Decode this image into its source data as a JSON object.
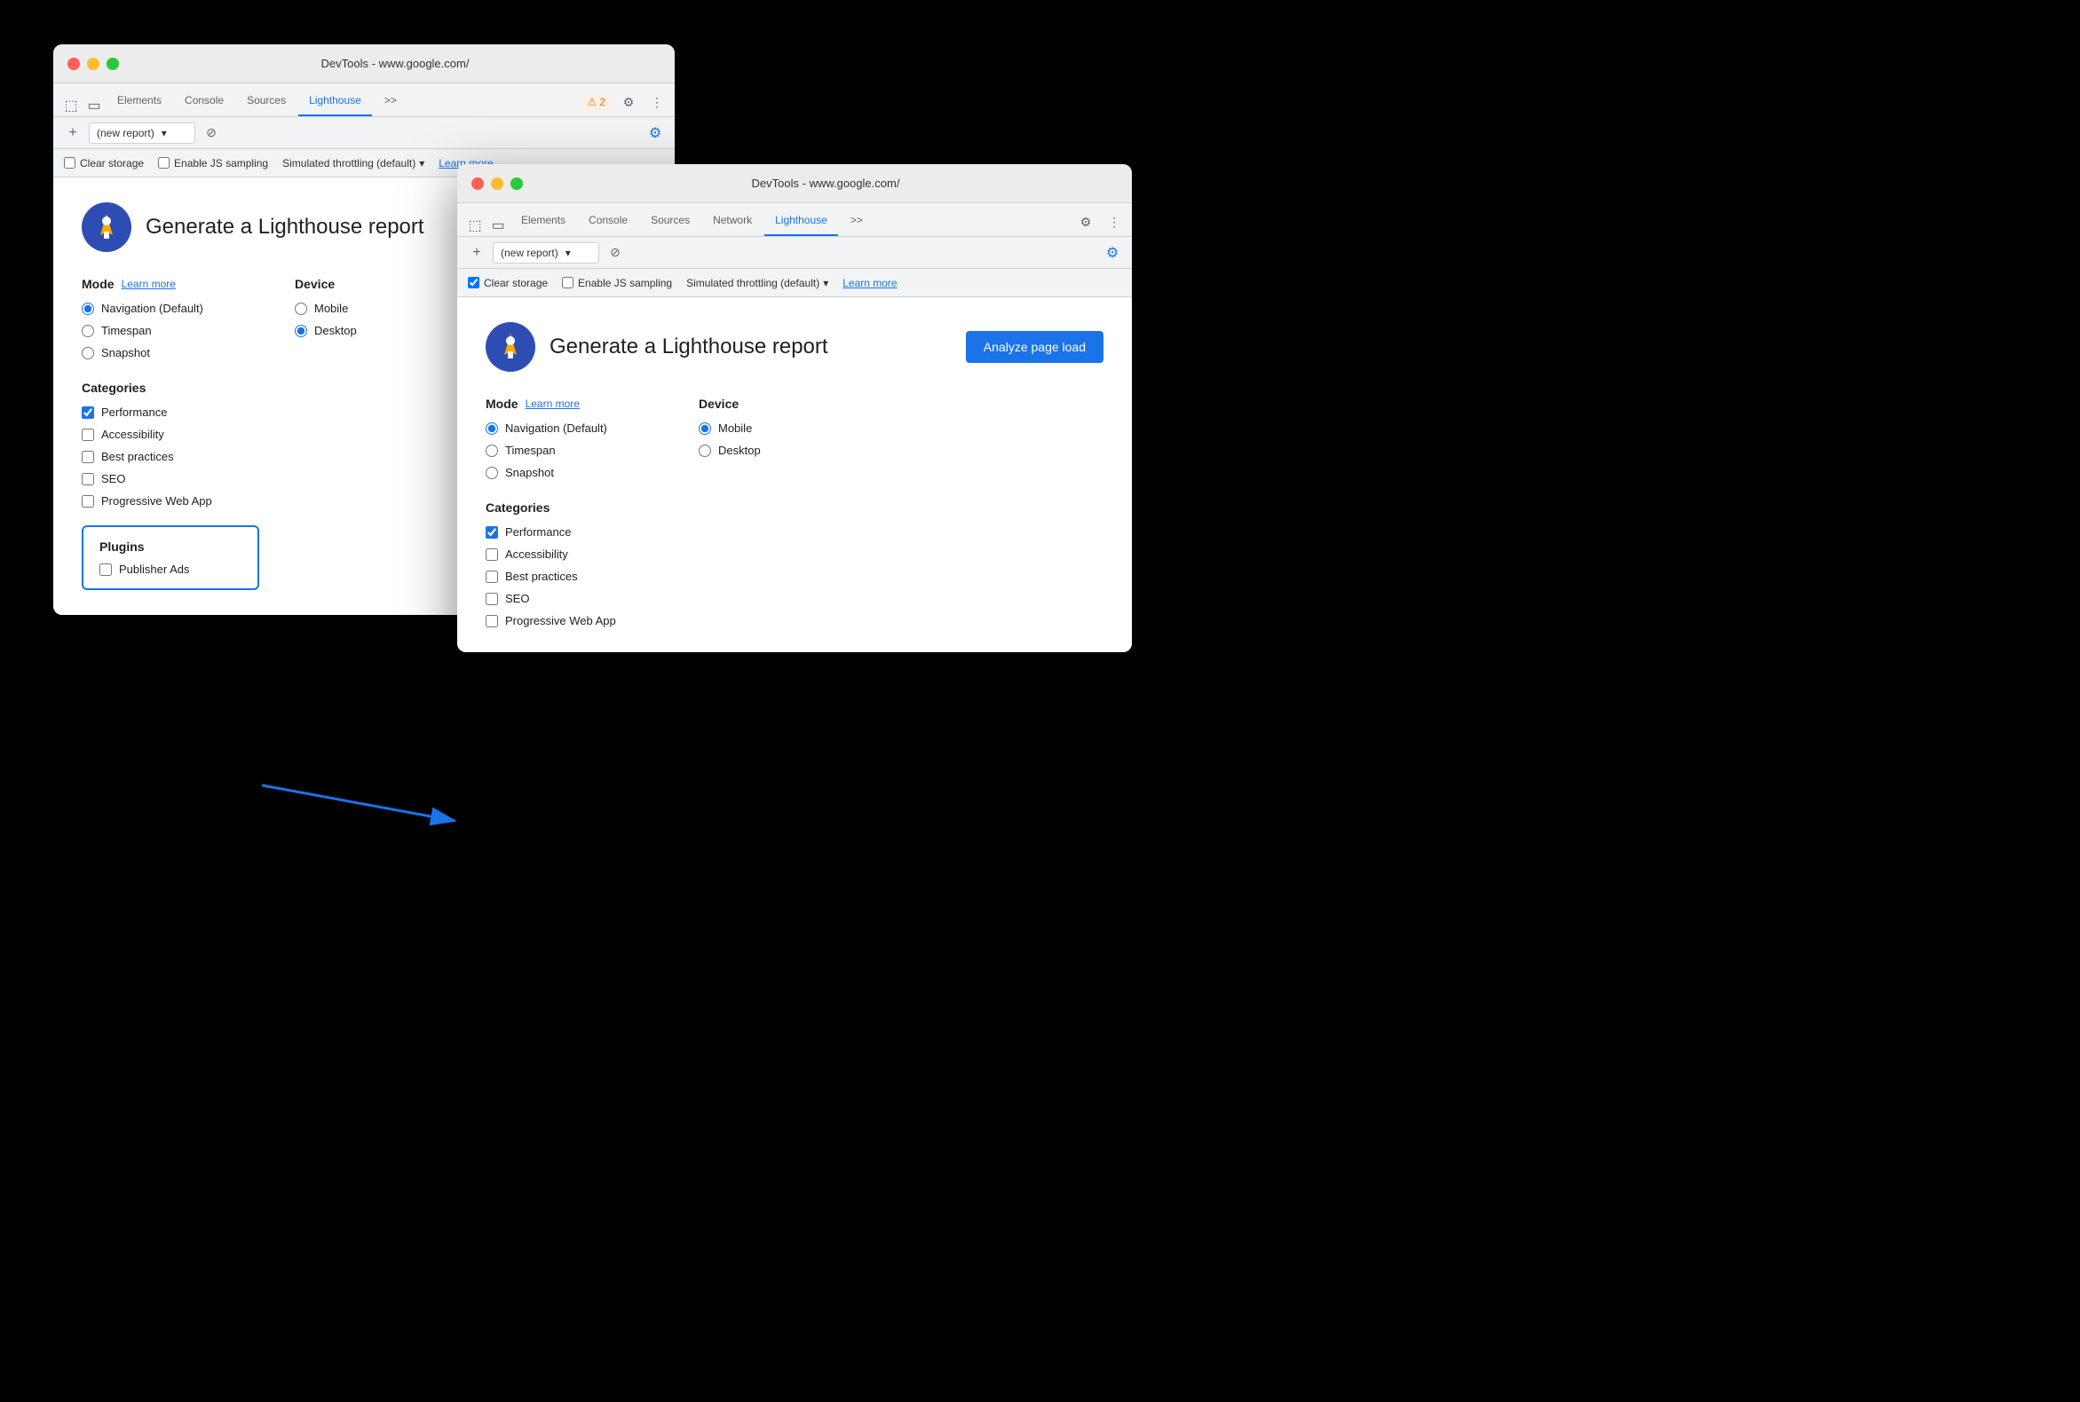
{
  "window1": {
    "titleBar": {
      "title": "DevTools - www.google.com/"
    },
    "tabs": [
      {
        "label": "Elements",
        "active": false
      },
      {
        "label": "Console",
        "active": false
      },
      {
        "label": "Sources",
        "active": false
      },
      {
        "label": "Lighthouse",
        "active": true
      }
    ],
    "tabsExtra": ">>",
    "warningBadge": "2",
    "reportToolbar": {
      "addLabel": "+",
      "placeholder": "(new report)",
      "clearLabel": "⊘"
    },
    "optionsToolbar": {
      "clearStorage": "Clear storage",
      "enableJSSampling": "Enable JS sampling",
      "throttling": "Simulated throttling (default)",
      "learnMore": "Learn more"
    },
    "panel": {
      "logoAlt": "Lighthouse logo",
      "title": "Generate a Lighthouse report",
      "modeLabel": "Mode",
      "learnMoreLink": "Learn more",
      "deviceLabel": "Device",
      "modes": [
        {
          "label": "Navigation (Default)",
          "checked": true
        },
        {
          "label": "Timespan",
          "checked": false
        },
        {
          "label": "Snapshot",
          "checked": false
        }
      ],
      "devices": [
        {
          "label": "Mobile",
          "checked": false
        },
        {
          "label": "Desktop",
          "checked": true
        }
      ],
      "categoriesLabel": "Categories",
      "categories": [
        {
          "label": "Performance",
          "checked": true
        },
        {
          "label": "Accessibility",
          "checked": false
        },
        {
          "label": "Best practices",
          "checked": false
        },
        {
          "label": "SEO",
          "checked": false
        },
        {
          "label": "Progressive Web App",
          "checked": false
        }
      ],
      "pluginsLabel": "Plugins",
      "plugins": [
        {
          "label": "Publisher Ads",
          "checked": false
        }
      ]
    }
  },
  "window2": {
    "titleBar": {
      "title": "DevTools - www.google.com/"
    },
    "tabs": [
      {
        "label": "Elements",
        "active": false
      },
      {
        "label": "Console",
        "active": false
      },
      {
        "label": "Sources",
        "active": false
      },
      {
        "label": "Network",
        "active": false
      },
      {
        "label": "Lighthouse",
        "active": true
      }
    ],
    "tabsExtra": ">>",
    "reportToolbar": {
      "addLabel": "+",
      "placeholder": "(new report)",
      "clearLabel": "⊘"
    },
    "optionsToolbar": {
      "clearStorage": "Clear storage",
      "clearStorageChecked": true,
      "enableJSSampling": "Enable JS sampling",
      "throttling": "Simulated throttling (default)",
      "learnMore": "Learn more"
    },
    "panel": {
      "logoAlt": "Lighthouse logo",
      "title": "Generate a Lighthouse report",
      "analyzeBtn": "Analyze page load",
      "modeLabel": "Mode",
      "learnMoreLink": "Learn more",
      "deviceLabel": "Device",
      "modes": [
        {
          "label": "Navigation (Default)",
          "checked": true
        },
        {
          "label": "Timespan",
          "checked": false
        },
        {
          "label": "Snapshot",
          "checked": false
        }
      ],
      "devices": [
        {
          "label": "Mobile",
          "checked": true
        },
        {
          "label": "Desktop",
          "checked": false
        }
      ],
      "categoriesLabel": "Categories",
      "categories": [
        {
          "label": "Performance",
          "checked": true
        },
        {
          "label": "Accessibility",
          "checked": false
        },
        {
          "label": "Best practices",
          "checked": false
        },
        {
          "label": "SEO",
          "checked": false
        },
        {
          "label": "Progressive Web App",
          "checked": false
        }
      ]
    }
  }
}
